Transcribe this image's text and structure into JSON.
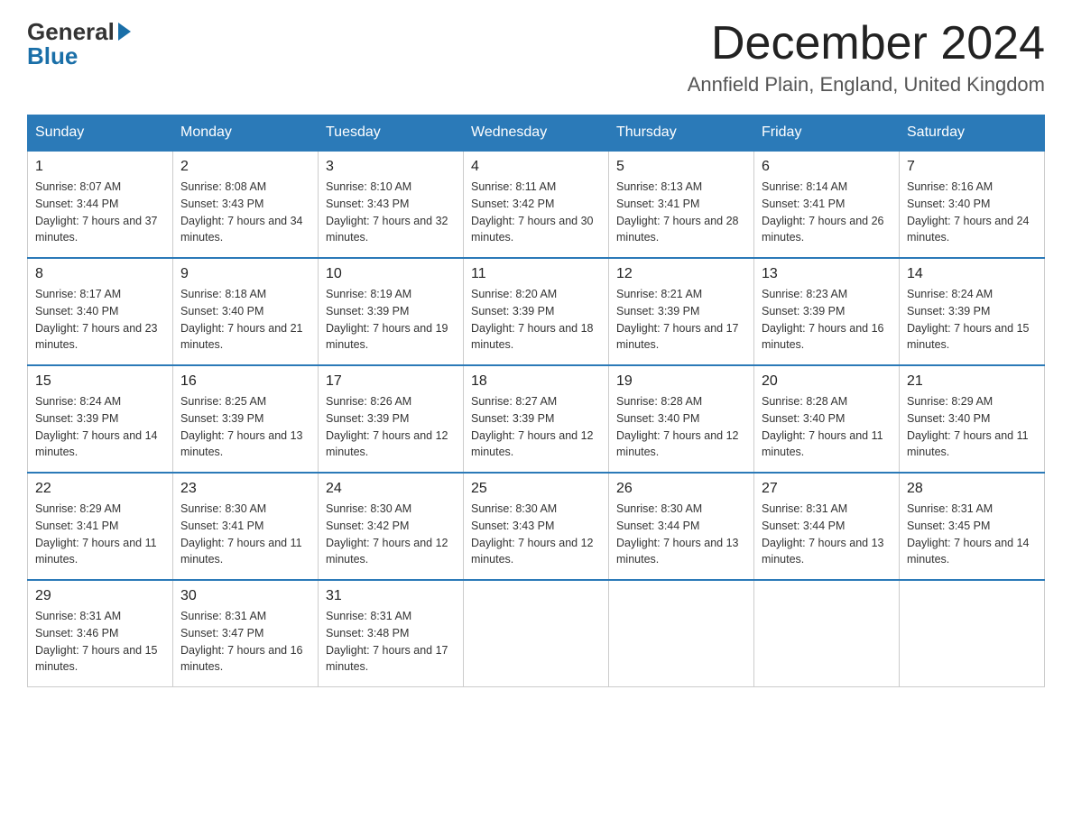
{
  "header": {
    "logo_general": "General",
    "logo_blue": "Blue",
    "month_title": "December 2024",
    "location": "Annfield Plain, England, United Kingdom"
  },
  "days_of_week": [
    "Sunday",
    "Monday",
    "Tuesday",
    "Wednesday",
    "Thursday",
    "Friday",
    "Saturday"
  ],
  "weeks": [
    [
      {
        "day": "1",
        "sunrise": "8:07 AM",
        "sunset": "3:44 PM",
        "daylight": "7 hours and 37 minutes."
      },
      {
        "day": "2",
        "sunrise": "8:08 AM",
        "sunset": "3:43 PM",
        "daylight": "7 hours and 34 minutes."
      },
      {
        "day": "3",
        "sunrise": "8:10 AM",
        "sunset": "3:43 PM",
        "daylight": "7 hours and 32 minutes."
      },
      {
        "day": "4",
        "sunrise": "8:11 AM",
        "sunset": "3:42 PM",
        "daylight": "7 hours and 30 minutes."
      },
      {
        "day": "5",
        "sunrise": "8:13 AM",
        "sunset": "3:41 PM",
        "daylight": "7 hours and 28 minutes."
      },
      {
        "day": "6",
        "sunrise": "8:14 AM",
        "sunset": "3:41 PM",
        "daylight": "7 hours and 26 minutes."
      },
      {
        "day": "7",
        "sunrise": "8:16 AM",
        "sunset": "3:40 PM",
        "daylight": "7 hours and 24 minutes."
      }
    ],
    [
      {
        "day": "8",
        "sunrise": "8:17 AM",
        "sunset": "3:40 PM",
        "daylight": "7 hours and 23 minutes."
      },
      {
        "day": "9",
        "sunrise": "8:18 AM",
        "sunset": "3:40 PM",
        "daylight": "7 hours and 21 minutes."
      },
      {
        "day": "10",
        "sunrise": "8:19 AM",
        "sunset": "3:39 PM",
        "daylight": "7 hours and 19 minutes."
      },
      {
        "day": "11",
        "sunrise": "8:20 AM",
        "sunset": "3:39 PM",
        "daylight": "7 hours and 18 minutes."
      },
      {
        "day": "12",
        "sunrise": "8:21 AM",
        "sunset": "3:39 PM",
        "daylight": "7 hours and 17 minutes."
      },
      {
        "day": "13",
        "sunrise": "8:23 AM",
        "sunset": "3:39 PM",
        "daylight": "7 hours and 16 minutes."
      },
      {
        "day": "14",
        "sunrise": "8:24 AM",
        "sunset": "3:39 PM",
        "daylight": "7 hours and 15 minutes."
      }
    ],
    [
      {
        "day": "15",
        "sunrise": "8:24 AM",
        "sunset": "3:39 PM",
        "daylight": "7 hours and 14 minutes."
      },
      {
        "day": "16",
        "sunrise": "8:25 AM",
        "sunset": "3:39 PM",
        "daylight": "7 hours and 13 minutes."
      },
      {
        "day": "17",
        "sunrise": "8:26 AM",
        "sunset": "3:39 PM",
        "daylight": "7 hours and 12 minutes."
      },
      {
        "day": "18",
        "sunrise": "8:27 AM",
        "sunset": "3:39 PM",
        "daylight": "7 hours and 12 minutes."
      },
      {
        "day": "19",
        "sunrise": "8:28 AM",
        "sunset": "3:40 PM",
        "daylight": "7 hours and 12 minutes."
      },
      {
        "day": "20",
        "sunrise": "8:28 AM",
        "sunset": "3:40 PM",
        "daylight": "7 hours and 11 minutes."
      },
      {
        "day": "21",
        "sunrise": "8:29 AM",
        "sunset": "3:40 PM",
        "daylight": "7 hours and 11 minutes."
      }
    ],
    [
      {
        "day": "22",
        "sunrise": "8:29 AM",
        "sunset": "3:41 PM",
        "daylight": "7 hours and 11 minutes."
      },
      {
        "day": "23",
        "sunrise": "8:30 AM",
        "sunset": "3:41 PM",
        "daylight": "7 hours and 11 minutes."
      },
      {
        "day": "24",
        "sunrise": "8:30 AM",
        "sunset": "3:42 PM",
        "daylight": "7 hours and 12 minutes."
      },
      {
        "day": "25",
        "sunrise": "8:30 AM",
        "sunset": "3:43 PM",
        "daylight": "7 hours and 12 minutes."
      },
      {
        "day": "26",
        "sunrise": "8:30 AM",
        "sunset": "3:44 PM",
        "daylight": "7 hours and 13 minutes."
      },
      {
        "day": "27",
        "sunrise": "8:31 AM",
        "sunset": "3:44 PM",
        "daylight": "7 hours and 13 minutes."
      },
      {
        "day": "28",
        "sunrise": "8:31 AM",
        "sunset": "3:45 PM",
        "daylight": "7 hours and 14 minutes."
      }
    ],
    [
      {
        "day": "29",
        "sunrise": "8:31 AM",
        "sunset": "3:46 PM",
        "daylight": "7 hours and 15 minutes."
      },
      {
        "day": "30",
        "sunrise": "8:31 AM",
        "sunset": "3:47 PM",
        "daylight": "7 hours and 16 minutes."
      },
      {
        "day": "31",
        "sunrise": "8:31 AM",
        "sunset": "3:48 PM",
        "daylight": "7 hours and 17 minutes."
      },
      null,
      null,
      null,
      null
    ]
  ]
}
